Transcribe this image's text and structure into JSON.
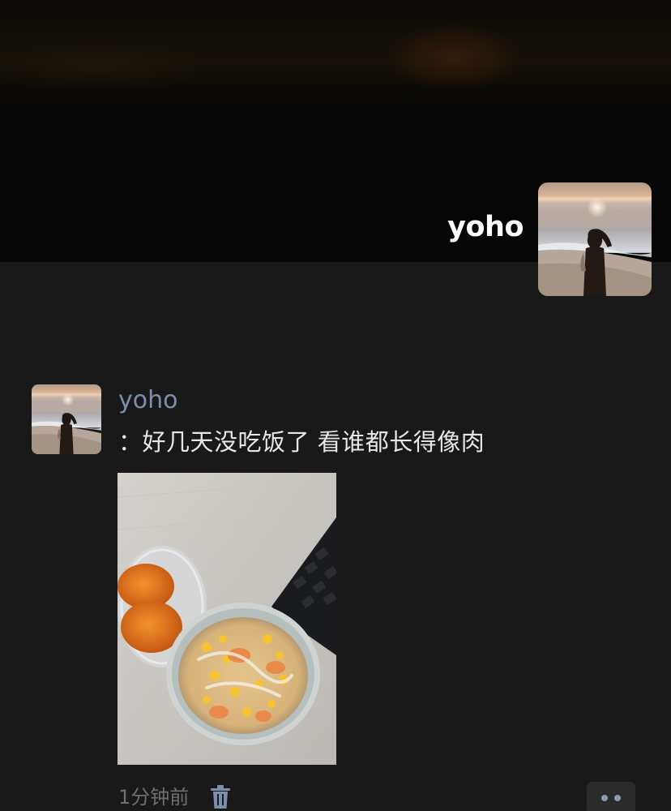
{
  "header": {
    "user_name": "yoho"
  },
  "post": {
    "author": "yoho",
    "text": "：好几天没吃饭了 看谁都长得像肉",
    "time": "1分钟前"
  },
  "icons": {
    "avatar": "profile-avatar-beach-sunset",
    "delete": "trash-icon",
    "more": "more-dots-icon"
  },
  "colors": {
    "background": "#191919",
    "author_name": "#7d8eab",
    "text": "#e6e6e6",
    "time": "#6f6f6f",
    "more_dots": "#8a9ab3"
  }
}
